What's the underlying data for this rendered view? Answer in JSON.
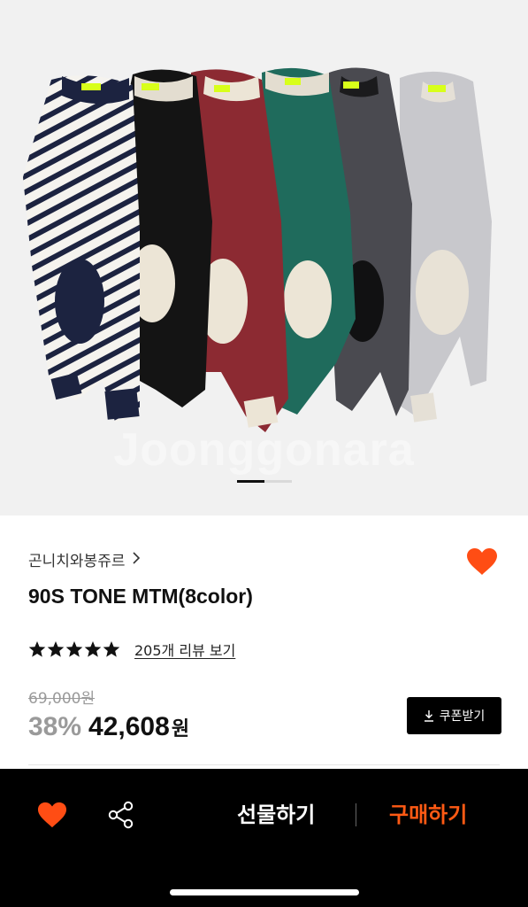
{
  "hero": {
    "watermark": "Joonggonara",
    "image_label": "sweatshirts-product-photo",
    "carousel": {
      "pages": 2,
      "active": 1
    }
  },
  "product": {
    "brand": "곤니치와봉쥬르",
    "title": "90S TONE MTM(8color)",
    "rating_stars": 5,
    "review_link": "205개 리뷰 보기",
    "original_price": "69,000원",
    "discount": "38%",
    "price": "42,608",
    "price_unit": "원",
    "coupon_label": "쿠폰받기"
  },
  "bottom_bar": {
    "gift_label": "선물하기",
    "buy_label": "구매하기"
  },
  "colors": {
    "accent": "#ff5a14",
    "heart": "#ff4d14",
    "bar_bg": "#000000",
    "hero_bg": "#f1f1f1"
  },
  "icons": {
    "wishlist": "heart-icon",
    "share": "share-icon",
    "download": "download-icon",
    "chevron": "chevron-right-icon",
    "star": "star-icon"
  }
}
